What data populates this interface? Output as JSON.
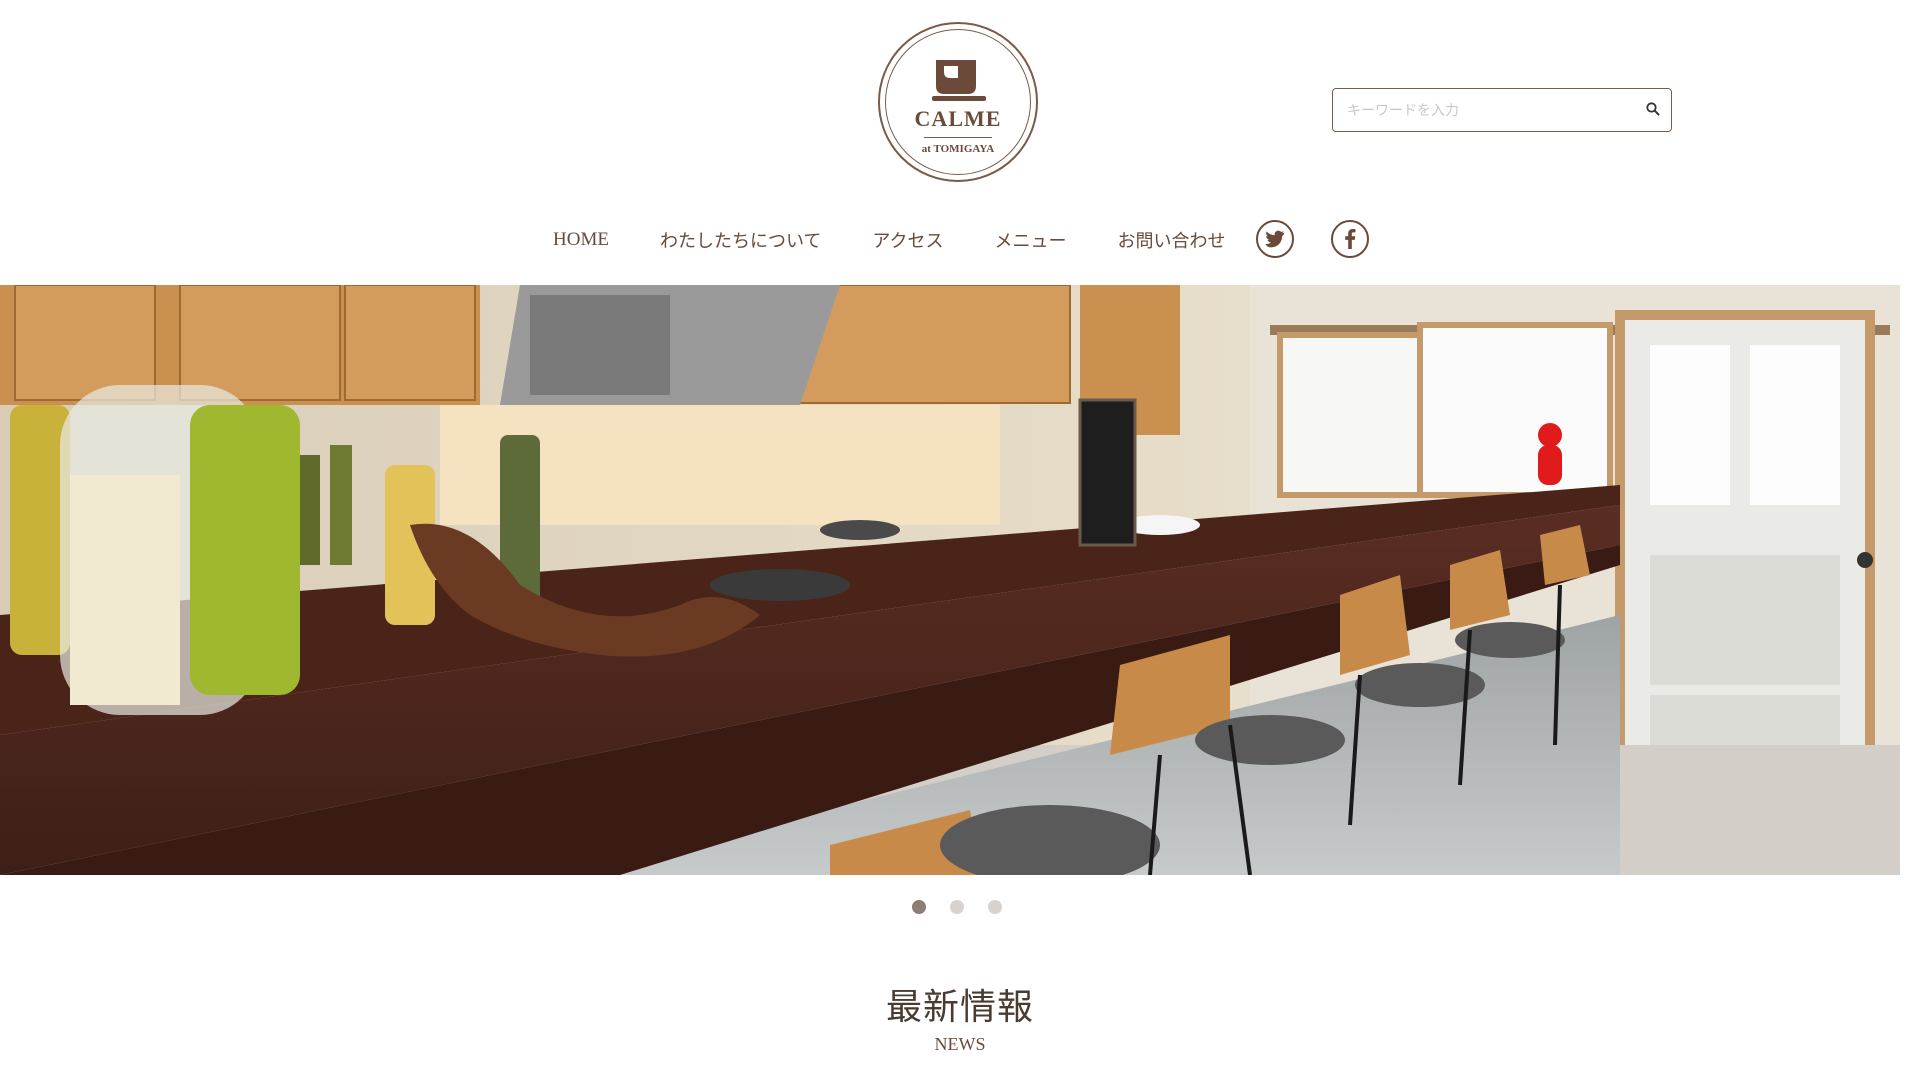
{
  "logo": {
    "title": "CALME",
    "subtitle": "at TOMIGAYA",
    "icon": "coffee-cup-icon",
    "color": "#6b4a3a"
  },
  "search": {
    "placeholder": "キーワードを入力",
    "value": "",
    "icon": "search-icon"
  },
  "nav": {
    "items": [
      {
        "label": "HOME"
      },
      {
        "label": "わたしたちについて"
      },
      {
        "label": "アクセス"
      },
      {
        "label": "メニュー"
      },
      {
        "label": "お問い合わせ"
      }
    ],
    "social": [
      {
        "icon": "twitter-icon"
      },
      {
        "icon": "facebook-icon"
      }
    ]
  },
  "hero": {
    "carousel_slide_count": 3,
    "active_slide": 1
  },
  "news": {
    "title": "最新情報",
    "subtitle": "NEWS"
  },
  "colors": {
    "brand": "#6b4a3a",
    "text": "#4b3a30",
    "dot_active": "#8f7d73",
    "dot_inactive": "#d7d2ce"
  }
}
